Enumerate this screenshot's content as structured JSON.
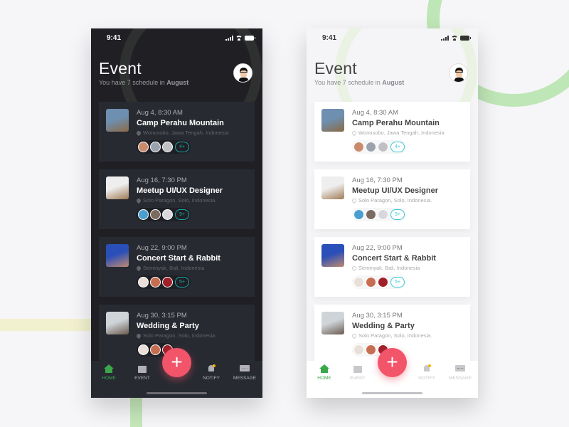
{
  "status_bar": {
    "time": "9:41"
  },
  "header": {
    "title": "Event",
    "subtitle_prefix": "You have 7 schedule in ",
    "subtitle_month": "August"
  },
  "events": [
    {
      "date": "Aug 4, 8:30 AM",
      "name": "Camp Perahu Mountain",
      "location": "Wonosobo, Jawa Tengah, Indonesia",
      "more": "4+",
      "thumb_colors": [
        "#6e8fb0",
        "#8a6a45"
      ],
      "attendee_colors": [
        "#c98b6b",
        "#9aa3ad",
        "#c0c0c4"
      ]
    },
    {
      "date": "Aug 16, 7:30 PM",
      "name": "Meetup UI/UX Designer",
      "location": "Solo Paragon, Solo, Indonesia.",
      "more": "9+",
      "thumb_colors": [
        "#eeeeee",
        "#a07a55"
      ],
      "attendee_colors": [
        "#4a9fd0",
        "#7a6a60",
        "#d8d8dc"
      ]
    },
    {
      "date": "Aug 22, 9:00 PM",
      "name": "Concert Start & Rabbit",
      "location": "Seminyak, Bali, Indonesia",
      "more": "5+",
      "thumb_colors": [
        "#2a4fb8",
        "#c08a70"
      ],
      "attendee_colors": [
        "#e8e0d8",
        "#c86e50",
        "#a0202a"
      ]
    },
    {
      "date": "Aug 30, 3:15 PM",
      "name": "Wedding & Party",
      "location": "Solo Paragon, Solo, Indonesia.",
      "more": "",
      "thumb_colors": [
        "#cfd4d8",
        "#6a5a50"
      ],
      "attendee_colors": [
        "#e8e0d8",
        "#c86e50",
        "#a0202a"
      ]
    }
  ],
  "tabbar": {
    "items": [
      {
        "label": "HOME",
        "icon": "home-icon",
        "active": true
      },
      {
        "label": "EVENT",
        "icon": "calendar-icon",
        "active": false
      },
      {
        "label": "NOTIFY",
        "icon": "bell-icon",
        "active": false
      },
      {
        "label": "MESSAGE",
        "icon": "message-icon",
        "active": false
      }
    ],
    "fab_label": "+"
  },
  "colors": {
    "accent_green": "#3aa84a",
    "fab_red": "#f2546a",
    "badge_teal": "#1aa6a6",
    "notify_dot": "#f2b600"
  }
}
